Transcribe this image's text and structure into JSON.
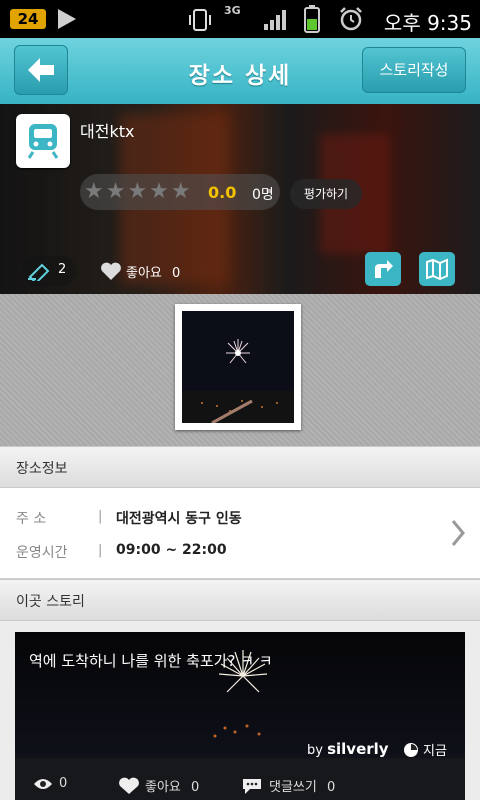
{
  "status_bar": {
    "badge": "24",
    "network": "3G",
    "time": "오후 9:35"
  },
  "header": {
    "title": "장소 상세",
    "story_button": "스토리작성"
  },
  "place": {
    "name": "대전ktx",
    "rating_value": "0.0",
    "rating_count": "0명",
    "rate_button": "평가하기",
    "story_count": "2",
    "like_label": "좋아요",
    "like_count": "0"
  },
  "sections": {
    "place_info": "장소정보",
    "stories": "이곳 스토리"
  },
  "info": {
    "address_label": "주 소",
    "address": "대전광역시 동구 인동",
    "hours_label": "운영시간",
    "hours": "09:00 ~ 22:00"
  },
  "story": {
    "text": "역에 도착하니 나를 위한 축포가? ㅋ ㅋ",
    "by_prefix": "by",
    "author": "silverly",
    "time": "지금",
    "views": "0",
    "like_label": "좋아요",
    "like_count": "0",
    "comment_label": "댓글쓰기",
    "comment_count": "0"
  },
  "colors": {
    "accent": "#36b3c4",
    "rating": "#f2c200"
  }
}
